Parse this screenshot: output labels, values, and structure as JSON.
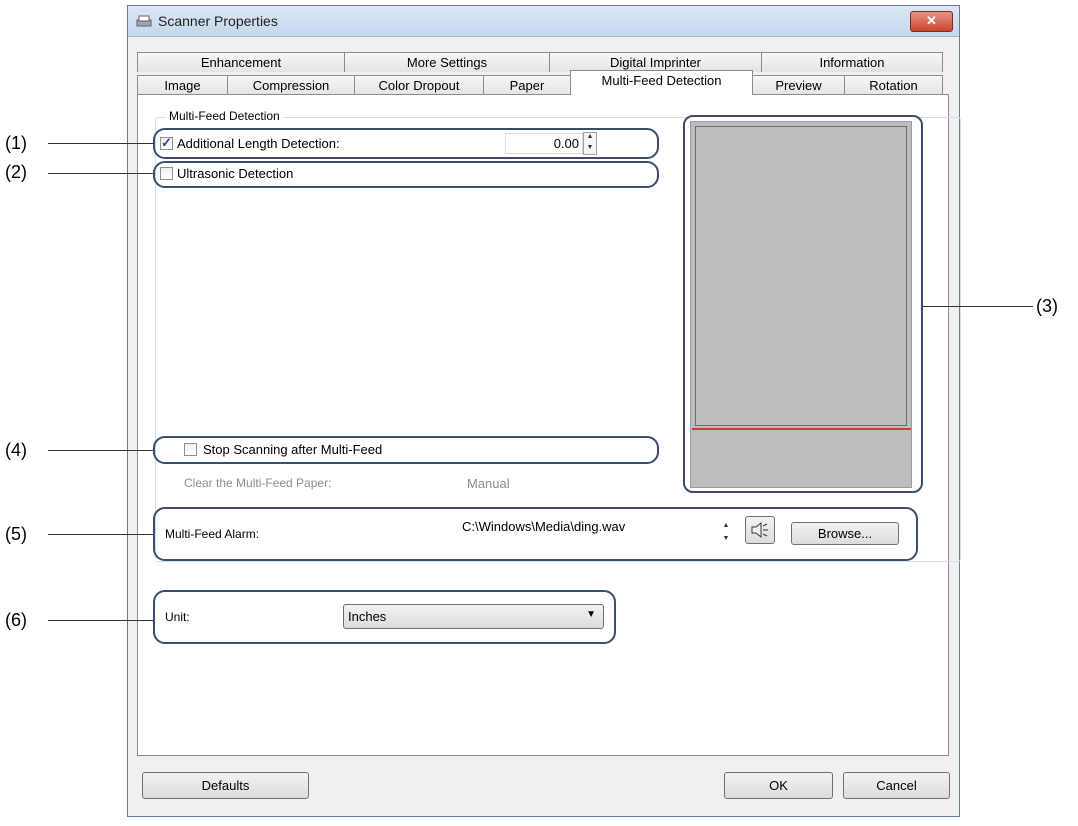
{
  "window": {
    "title": "Scanner Properties"
  },
  "tabs_row1": [
    "Enhancement",
    "More Settings",
    "Digital Imprinter",
    "Information"
  ],
  "tabs_row2": [
    "Image",
    "Compression",
    "Color Dropout",
    "Paper",
    "Multi-Feed Detection",
    "Preview",
    "Rotation"
  ],
  "active_tab": "Multi-Feed Detection",
  "group": {
    "label": "Multi-Feed Detection"
  },
  "additional_length": {
    "label": "Additional Length Detection:",
    "checked": true,
    "value": "0.00"
  },
  "ultrasonic": {
    "label": "Ultrasonic Detection",
    "checked": false
  },
  "stop_scanning": {
    "label": "Stop Scanning after Multi-Feed",
    "checked": false
  },
  "clear_paper": {
    "label": "Clear the Multi-Feed Paper:",
    "value": "Manual"
  },
  "alarm": {
    "label": "Multi-Feed Alarm:",
    "path": "C:\\Windows\\Media\\ding.wav",
    "browse_label": "Browse..."
  },
  "unit": {
    "label": "Unit:",
    "selected": "Inches"
  },
  "buttons": {
    "defaults": "Defaults",
    "ok": "OK",
    "cancel": "Cancel"
  },
  "callouts": [
    "(1)",
    "(2)",
    "(3)",
    "(4)",
    "(5)",
    "(6)"
  ],
  "colors": {
    "accent_outline": "#3a4e6b",
    "preview_line": "#d23a3a",
    "preview_bg": "#bdbdbd"
  }
}
